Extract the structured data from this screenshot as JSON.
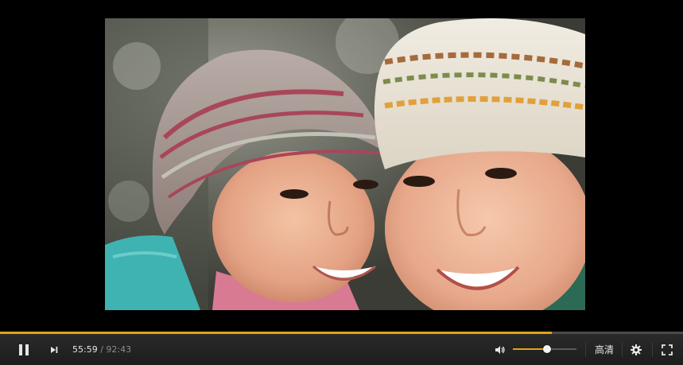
{
  "player": {
    "time": {
      "current": "55:59",
      "separator": "/",
      "total": "92:43"
    },
    "progress_fraction": 0.808,
    "volume_fraction": 0.54,
    "quality_label": "高清",
    "accent_color": "#e3a21a",
    "icons": {
      "play_pause": "pause-icon",
      "next": "next-track-icon",
      "volume": "speaker-icon",
      "settings": "gear-icon",
      "fullscreen": "fullscreen-icon"
    }
  }
}
